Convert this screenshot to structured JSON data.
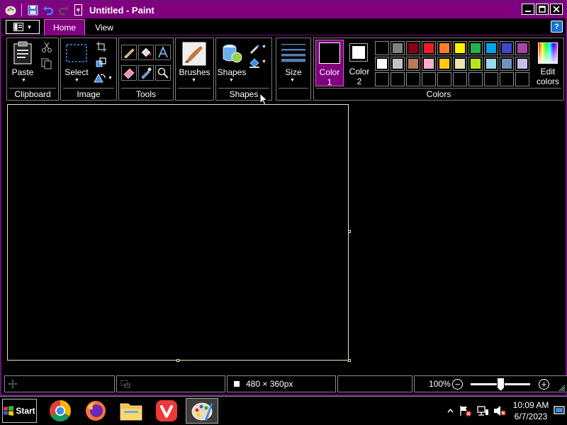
{
  "window": {
    "title": "Untitled - Paint"
  },
  "tabs": {
    "home": "Home",
    "view": "View"
  },
  "ribbon": {
    "clipboard": {
      "label": "Clipboard",
      "paste": "Paste"
    },
    "image": {
      "label": "Image",
      "select": "Select"
    },
    "tools": {
      "label": "Tools"
    },
    "brushes": {
      "label": "Brushes"
    },
    "shapes": {
      "label": "Shapes",
      "button": "Shapes"
    },
    "size": {
      "label": "Size"
    },
    "colors": {
      "label": "Colors",
      "color1_line1": "Color",
      "color1_line2": "1",
      "color2_line1": "Color",
      "color2_line2": "2",
      "edit_line1": "Edit",
      "edit_line2": "colors",
      "color1_value": "#000000",
      "color2_value": "#ffffff",
      "palette_row1": [
        "#000000",
        "#7f7f7f",
        "#880015",
        "#ed1c24",
        "#ff7f27",
        "#fff200",
        "#22b14c",
        "#00a2e8",
        "#3f48cc",
        "#a349a4"
      ],
      "palette_row2": [
        "#ffffff",
        "#c3c3c3",
        "#b97a57",
        "#ffaec9",
        "#ffc90e",
        "#efe4b0",
        "#b5e61d",
        "#99d9ea",
        "#7092be",
        "#c8bfe7"
      ]
    }
  },
  "statusbar": {
    "dimensions": "480 × 360px",
    "zoom": "100%",
    "zoom_fraction": 0.5
  },
  "taskbar": {
    "start": "Start",
    "time": "10:09 AM",
    "date": "6/7/2023"
  },
  "theme": {
    "accent": "#800080",
    "border": "#7a7a7a"
  }
}
